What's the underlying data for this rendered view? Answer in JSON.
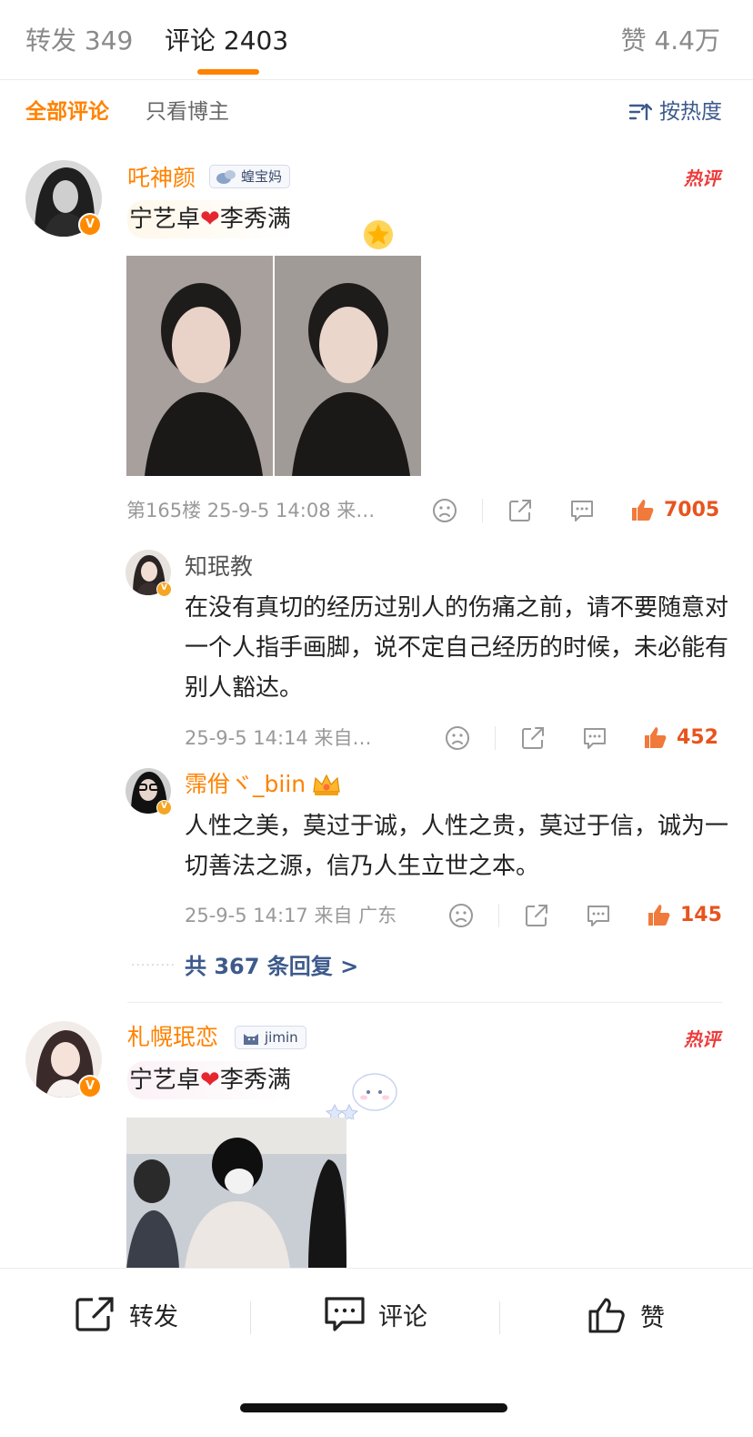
{
  "tabs": {
    "repost_label": "转发 349",
    "comments_label": "评论 2403",
    "likes_label": "赞 4.4万"
  },
  "filters": {
    "all": "全部评论",
    "author_only": "只看博主",
    "sort": "按热度"
  },
  "comments": [
    {
      "username": "吒神颜",
      "tag": "蝗宝妈",
      "hot_badge": "热评",
      "text_a": "宁艺卓",
      "text_b": "李秀满",
      "meta": "第165楼 25-9-5 14:08 来…",
      "likes": "7005",
      "replies": [
        {
          "username": "知珉教",
          "text": "在没有真切的经历过别人的伤痛之前，请不要随意对一个人指手画脚，说不定自己经历的时候，未必能有别人豁达。",
          "meta": "25-9-5 14:14 来自…",
          "likes": "452"
        },
        {
          "username": "霈佾ヾ_biin",
          "text": "人性之美，莫过于诚，人性之贵，莫过于信，诚为一切善法之源，信乃人生立世之本。",
          "meta": "25-9-5 14:17 来自 广东",
          "likes": "145"
        }
      ],
      "more_replies": "共 367 条回复 >"
    },
    {
      "username": "札幌珉恋",
      "tag": "jimin",
      "hot_badge": "热评",
      "text_a": "宁艺卓",
      "text_b": "李秀满"
    }
  ],
  "bottom_bar": {
    "repost": "转发",
    "comment": "评论",
    "like": "赞"
  },
  "colors": {
    "accent_orange": "#ff8200",
    "link_blue": "#3d5a8c",
    "like_red": "#e8541e",
    "hot_red": "#ee3b3b"
  }
}
